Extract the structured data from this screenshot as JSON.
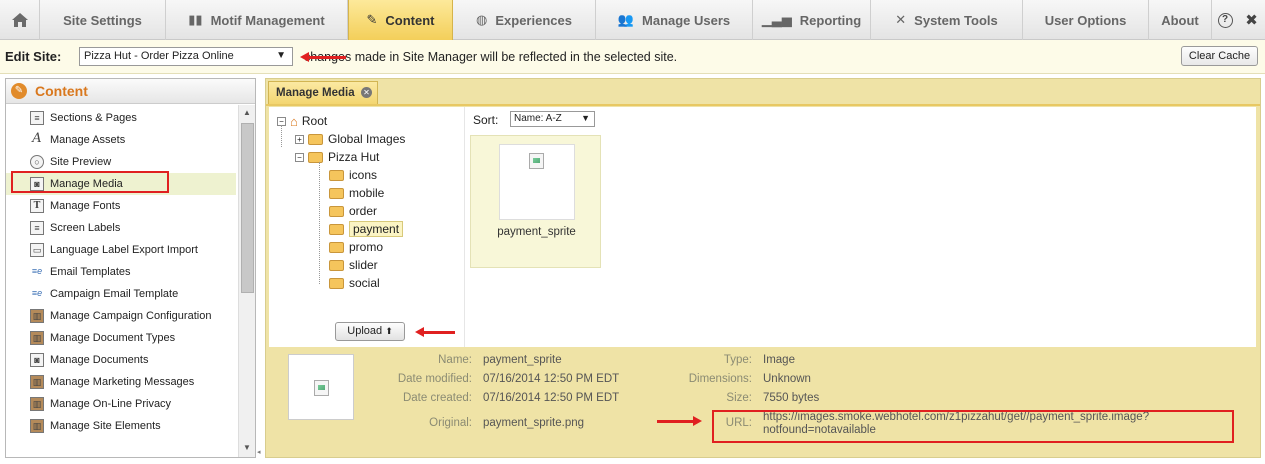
{
  "nav": {
    "home_icon": "home-icon",
    "tabs": [
      {
        "label": "Site Settings",
        "icon": ""
      },
      {
        "label": "Motif Management",
        "icon": "motif-icon"
      },
      {
        "label": "Content",
        "icon": "content-icon"
      },
      {
        "label": "Experiences",
        "icon": "globe-icon"
      },
      {
        "label": "Manage Users",
        "icon": "users-icon"
      },
      {
        "label": "Reporting",
        "icon": "chart-icon"
      },
      {
        "label": "System Tools",
        "icon": "tools-icon"
      },
      {
        "label": "User Options",
        "icon": ""
      },
      {
        "label": "About",
        "icon": ""
      }
    ],
    "active_tab": "Content",
    "help_icon": "help-icon",
    "close_icon": "close-icon"
  },
  "editbar": {
    "label": "Edit Site:",
    "selected_site": "Pizza Hut - Order Pizza Online",
    "note": "changes made in Site Manager will be reflected in the selected site.",
    "clear_cache": "Clear Cache"
  },
  "sidebar": {
    "title": "Content",
    "items": [
      {
        "label": "Sections & Pages",
        "icon": "document-icon"
      },
      {
        "label": "Manage Assets",
        "icon": "font-a-icon"
      },
      {
        "label": "Site Preview",
        "icon": "magnifier-icon"
      },
      {
        "label": "Manage Media",
        "icon": "media-icon"
      },
      {
        "label": "Manage Fonts",
        "icon": "font-t-icon"
      },
      {
        "label": "Screen Labels",
        "icon": "document-icon"
      },
      {
        "label": "Language Label Export Import",
        "icon": "window-icon"
      },
      {
        "label": "Email Templates",
        "icon": "email-icon"
      },
      {
        "label": "Campaign Email Template",
        "icon": "email-icon"
      },
      {
        "label": "Manage Campaign Configuration",
        "icon": "bin-icon"
      },
      {
        "label": "Manage Document Types",
        "icon": "bin-icon"
      },
      {
        "label": "Manage Documents",
        "icon": "media-icon"
      },
      {
        "label": "Manage Marketing Messages",
        "icon": "bin-icon"
      },
      {
        "label": "Manage On-Line Privacy",
        "icon": "bin-icon"
      },
      {
        "label": "Manage Site Elements",
        "icon": "bin-icon"
      }
    ],
    "selected_item": "Manage Media"
  },
  "main": {
    "tab_label": "Manage Media",
    "tree": {
      "root": "Root",
      "nodes": [
        {
          "label": "Global Images",
          "level": 1,
          "toggle": "+"
        },
        {
          "label": "Pizza Hut",
          "level": 1,
          "toggle": "-"
        },
        {
          "label": "icons",
          "level": 2
        },
        {
          "label": "mobile",
          "level": 2
        },
        {
          "label": "order",
          "level": 2
        },
        {
          "label": "payment",
          "level": 2,
          "selected": true
        },
        {
          "label": "promo",
          "level": 2
        },
        {
          "label": "slider",
          "level": 2
        },
        {
          "label": "social",
          "level": 2
        }
      ]
    },
    "upload_label": "Upload",
    "sort": {
      "label": "Sort:",
      "value": "Name: A-Z"
    },
    "media_item": {
      "name": "payment_sprite"
    },
    "details": {
      "name_label": "Name:",
      "name": "payment_sprite",
      "modified_label": "Date modified:",
      "modified": "07/16/2014 12:50 PM EDT",
      "created_label": "Date created:",
      "created": "07/16/2014 12:50 PM EDT",
      "original_label": "Original:",
      "original": "payment_sprite.png",
      "type_label": "Type:",
      "type": "Image",
      "dimensions_label": "Dimensions:",
      "dimensions": "Unknown",
      "size_label": "Size:",
      "size": "7550 bytes",
      "url_label": "URL:",
      "url_line1": "https://images.smoke.webhotel.com/z1pizzahut/get//payment_sprite.image?",
      "url_line2": "notfound=notavailable"
    }
  },
  "colors": {
    "active_tab": "#f3cf5a",
    "accent_orange": "#d9781e",
    "annotation_red": "#e02020"
  }
}
